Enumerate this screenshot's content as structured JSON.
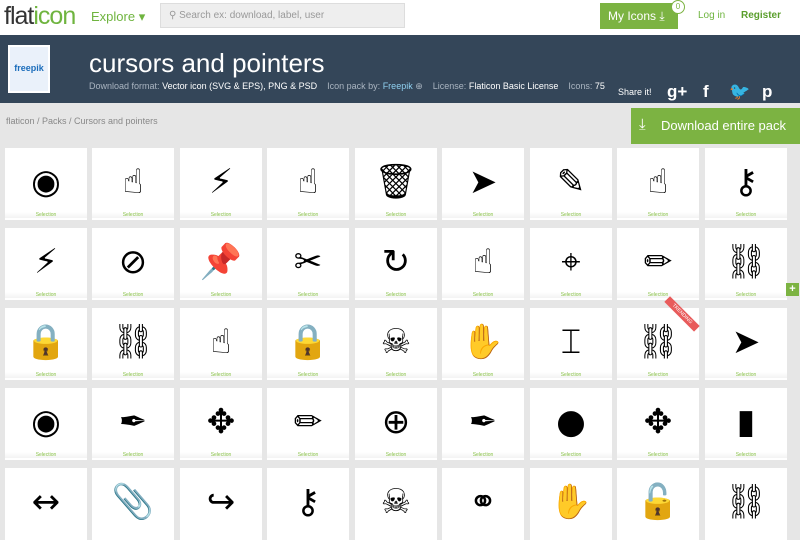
{
  "nav": {
    "logo": "flaticon",
    "explore": "Explore ▾",
    "search_placeholder": "Search ex: download, label, user",
    "my_icons": "My Icons",
    "my_icons_count": "0",
    "login": "Log in",
    "register": "Register"
  },
  "pack": {
    "logo_text": "freepik",
    "title": "cursors and pointers",
    "format_label": "Download format:",
    "format": "Vector icon (SVG & EPS), PNG & PSD",
    "by_label": "Icon pack by:",
    "by": "Freepik",
    "license_label": "License:",
    "license": "Flaticon Basic License",
    "icons_label": "Icons:",
    "icons": "75",
    "share": "Share it!"
  },
  "breadcrumb": "flaticon / Packs / Cursors and pointers",
  "download_label": "Download entire pack",
  "tile_label": "Selection",
  "trending": "TRENDING",
  "icons": [
    [
      "eye",
      "☝",
      "⚡",
      "☝",
      "🗑",
      "➤",
      "✎",
      "☝",
      "⚷"
    ],
    [
      "⚡",
      "⊘",
      "📌",
      "✂",
      "↻",
      "☝",
      "⌖",
      "✏",
      "⛓"
    ],
    [
      "🔒",
      "⛓",
      "☝",
      "🔒",
      "☠",
      "✋",
      "⌶",
      "⛓",
      "➤"
    ],
    [
      "◉",
      "✒",
      "✥",
      "✏",
      "⊕",
      "✒",
      "●",
      "✥",
      "▮"
    ],
    [
      "↔",
      "📎",
      "↪",
      "⚷",
      "☠",
      "⚭",
      "✋",
      "🔓",
      "⛓"
    ]
  ],
  "icon_names": [
    [
      "eye",
      "pointing-hand",
      "lightning",
      "touch-hand",
      "trash",
      "arrow-cursor",
      "pencil-circle",
      "keypad-hand",
      "key"
    ],
    [
      "lightning",
      "eye-slash",
      "pushpin",
      "scissors",
      "refresh",
      "hand-up",
      "crosshair",
      "pencil",
      "link"
    ],
    [
      "lock",
      "link",
      "hand-press",
      "padlock",
      "skull",
      "hand",
      "text-cursor",
      "broken-link",
      "arrow-cursor"
    ],
    [
      "eye",
      "pen",
      "move-arrows",
      "pencil",
      "crosshair",
      "quill-ink",
      "keyhole",
      "arrow-move",
      "bin"
    ],
    [
      "horizontal-resize",
      "paperclip",
      "curved-arrow",
      "key",
      "skull",
      "binoculars",
      "hand",
      "unlock",
      "link"
    ]
  ]
}
